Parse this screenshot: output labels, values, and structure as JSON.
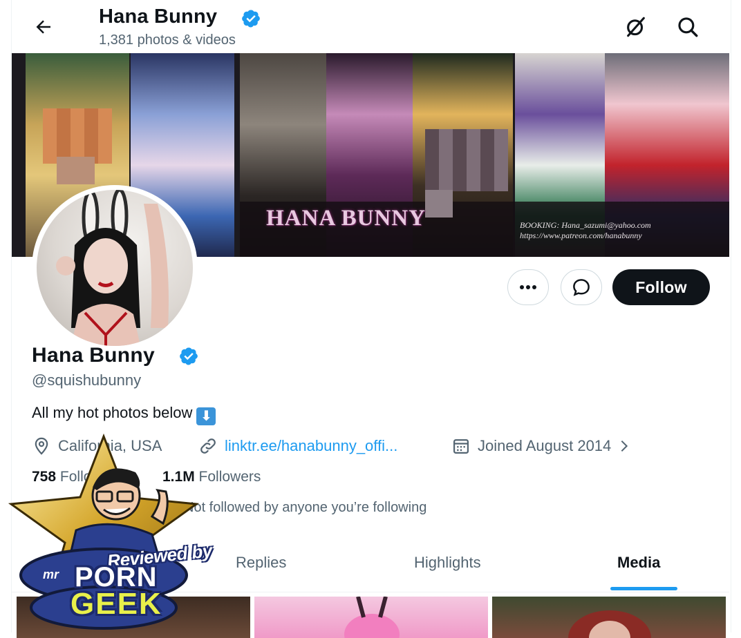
{
  "header": {
    "display_name": "Hana Bunny",
    "media_count": "1,381 photos & videos",
    "icons": [
      "back-arrow-icon",
      "grok-icon",
      "search-icon"
    ]
  },
  "banner": {
    "title": "HANA BUNNY",
    "booking_line1": "BOOKING:  Hana_sazumi@yahoo.com",
    "booking_line2": "https://www.patreon.com/hanabunny"
  },
  "actions": {
    "more_icon": "more-dots-icon",
    "message_icon": "message-icon",
    "follow_label": "Follow"
  },
  "profile": {
    "name": "Hana Bunny",
    "handle": "@squishubunny",
    "bio": "All my hot photos below",
    "bio_emoji": "⬇",
    "location": "California, USA",
    "link": "linktr.ee/hanabunny_offi...",
    "joined": "Joined August 2014",
    "following_count": "758",
    "following_label": "Following",
    "followers_count": "1.1M",
    "followers_label": "Followers",
    "followed_by": "Not followed by anyone you’re following"
  },
  "tabs": [
    {
      "label": "Replies"
    },
    {
      "label": "Highlights"
    },
    {
      "label": "Media",
      "active": true
    }
  ],
  "watermark": {
    "line1": "Reviewed by",
    "line2": "mr",
    "line3": "PORN",
    "line4": "GEEK"
  },
  "colors": {
    "accent": "#1d9bf0",
    "text": "#0f1419",
    "muted": "#536471"
  }
}
